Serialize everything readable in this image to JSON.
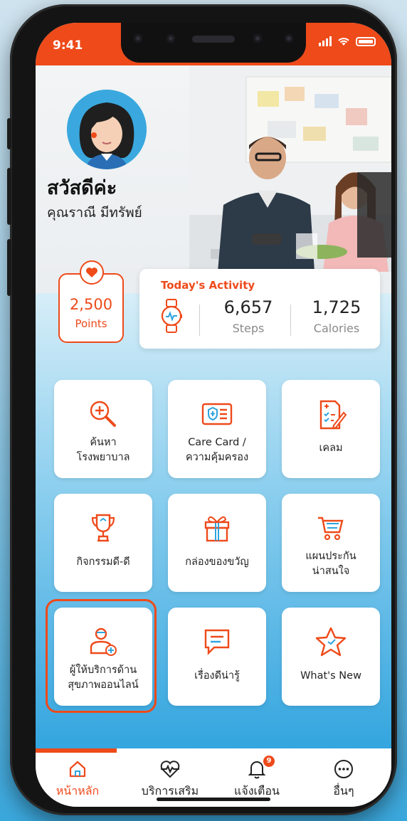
{
  "status_bar": {
    "time": "9:41"
  },
  "greeting": {
    "title": "สวัสดีค่ะ",
    "name": "คุณราณี มีทรัพย์"
  },
  "points": {
    "value": "2,500",
    "label": "Points",
    "icon": "heart-icon"
  },
  "activity": {
    "title": "Today's Activity",
    "icon": "smartwatch-icon",
    "steps": {
      "value": "6,657",
      "label": "Steps"
    },
    "calories": {
      "value": "1,725",
      "label": "Calories"
    }
  },
  "menu": [
    {
      "line1": "ค้นหา",
      "line2": "โรงพยาบาล",
      "icon": "hospital-search-icon"
    },
    {
      "line1": "Care Card /",
      "line2": "ความคุ้มครอง",
      "icon": "care-card-icon"
    },
    {
      "line1": "เคลม",
      "line2": "",
      "icon": "claim-document-icon"
    },
    {
      "line1": "กิจกรรมดี-ดี",
      "line2": "",
      "icon": "trophy-icon"
    },
    {
      "line1": "กล่องของขวัญ",
      "line2": "",
      "icon": "gift-box-icon"
    },
    {
      "line1": "แผนประกัน",
      "line2": "น่าสนใจ",
      "icon": "shopping-cart-icon"
    },
    {
      "line1": "ผู้ให้บริการด้าน",
      "line2": "สุขภาพออนไลน์",
      "icon": "online-doctor-icon"
    },
    {
      "line1": "เรื่องดีน่ารู้",
      "line2": "",
      "icon": "chat-article-icon"
    },
    {
      "line1": "What's New",
      "line2": "",
      "icon": "star-icon"
    }
  ],
  "tabbar": {
    "home": {
      "label": "หน้าหลัก",
      "icon": "home-icon"
    },
    "services": {
      "label": "บริการเสริม",
      "icon": "heart-pulse-icon"
    },
    "notifications": {
      "label": "แจ้งเตือน",
      "icon": "bell-icon",
      "badge": "9"
    },
    "more": {
      "label": "อื่นๆ",
      "icon": "more-dots-icon"
    }
  },
  "colors": {
    "accent": "#ee4a1a",
    "blue": "#2fa3de"
  }
}
